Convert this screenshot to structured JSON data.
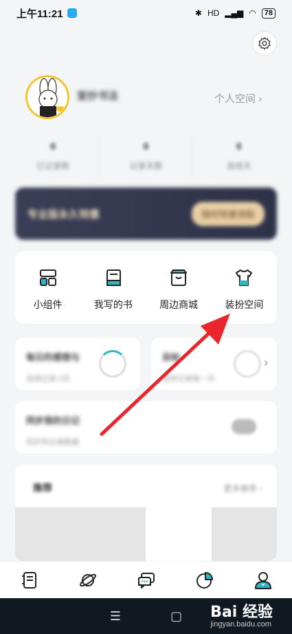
{
  "status_bar": {
    "time": "上午11:21",
    "network": "HD",
    "battery": "78"
  },
  "profile": {
    "username": "爱抄书法",
    "personal_space": "个人空间 ›"
  },
  "stats": [
    {
      "num": "0",
      "label": "已记录数"
    },
    {
      "num": "0",
      "label": "记录天数"
    },
    {
      "num": "0",
      "label": "连续天"
    }
  ],
  "vip": {
    "text": "专业版永久特惠",
    "button": "限时特惠领取"
  },
  "tools": [
    {
      "label": "小组件",
      "icon": "widget-icon"
    },
    {
      "label": "我写的书",
      "icon": "book-icon"
    },
    {
      "label": "周边商城",
      "icon": "shop-icon"
    },
    {
      "label": "装扮空间",
      "icon": "tshirt-icon"
    }
  ],
  "cards": {
    "habit_title": "每日的感想与",
    "habit_sub": "连续记录 0天",
    "goal_title": "目标",
    "goal_sub": "坚持记录每一天",
    "diary_title": "同步我的日记",
    "diary_sub": "同步到云端数据"
  },
  "recommend": {
    "title": "推荐",
    "more": "更多推荐 ›"
  },
  "nav": [
    "notebook-icon",
    "planet-icon",
    "chat-icon",
    "stats-icon",
    "profile-icon"
  ],
  "watermark": {
    "brand": "Bai 经验",
    "url": "jingyan.baidu.com"
  },
  "colors": {
    "accent": "#2fb6c4",
    "arrow": "#e8262c",
    "avatar_ring": "#f4c531"
  }
}
